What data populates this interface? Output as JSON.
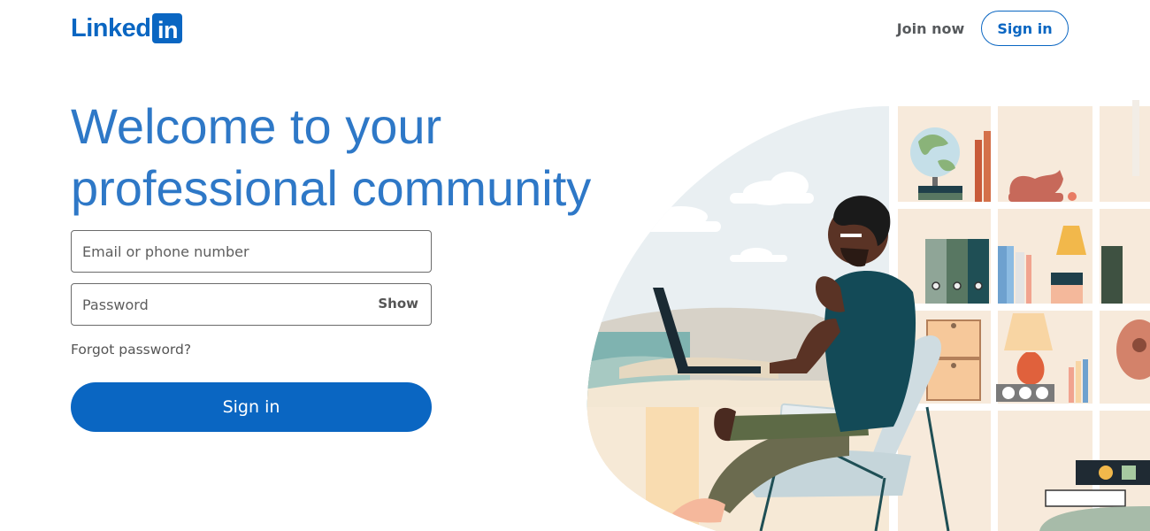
{
  "header": {
    "logo_text": "Linked",
    "logo_box_text": "in",
    "join_label": "Join now",
    "signin_label": "Sign in"
  },
  "hero": {
    "headline_line1": "Welcome to your",
    "headline_line2": "professional community"
  },
  "form": {
    "email_placeholder": "Email or phone number",
    "password_placeholder": "Password",
    "show_label": "Show",
    "forgot_label": "Forgot password?",
    "signin_label": "Sign in"
  },
  "colors": {
    "brand": "#0a66c2",
    "headline": "#2e78c7"
  }
}
